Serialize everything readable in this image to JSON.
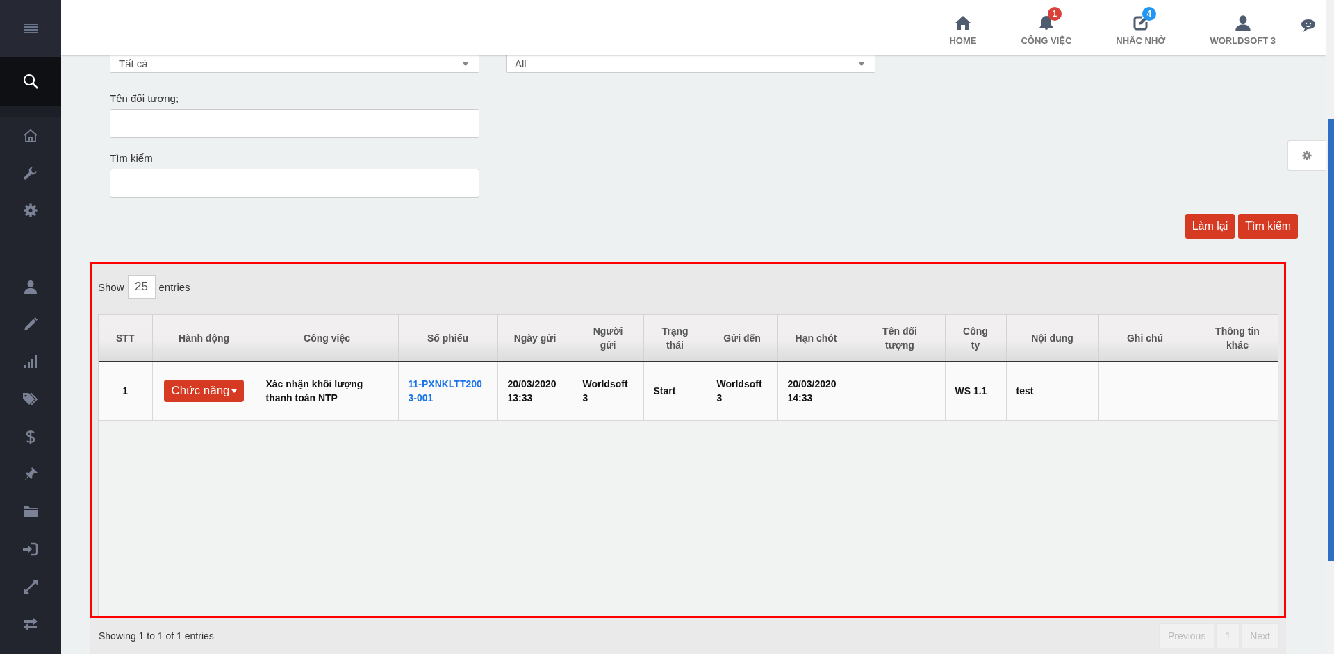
{
  "sidebar": {
    "items": [
      {
        "kind": "menu",
        "selected": false
      },
      {
        "kind": "search",
        "selected": true
      },
      {
        "kind": "home",
        "selected": false
      },
      {
        "kind": "wrench",
        "selected": false
      },
      {
        "kind": "gear",
        "selected": false
      },
      {
        "kind": "gap"
      },
      {
        "kind": "user",
        "selected": false
      },
      {
        "kind": "pencil",
        "selected": false
      },
      {
        "kind": "bars",
        "selected": false
      },
      {
        "kind": "tags",
        "selected": false
      },
      {
        "kind": "dollar",
        "selected": false
      },
      {
        "kind": "pin",
        "selected": false
      },
      {
        "kind": "folder",
        "selected": false
      },
      {
        "kind": "signin",
        "selected": false
      },
      {
        "kind": "expand",
        "selected": false
      },
      {
        "kind": "exchange",
        "selected": false
      }
    ]
  },
  "header": {
    "nav": [
      {
        "kind": "home",
        "label": "HOME"
      },
      {
        "kind": "bell",
        "label": "CÔNG VIỆC",
        "badge": "1",
        "color": "#d9413a"
      },
      {
        "kind": "edit",
        "label": "NHẮC NHỞ",
        "badge": "4",
        "color": "#2196f3"
      },
      {
        "kind": "user",
        "label": "WORLDSOFT 3"
      },
      {
        "kind": "chat"
      }
    ]
  },
  "filters": {
    "selects": [
      {
        "value": "Tất cả"
      },
      {
        "value": "All"
      }
    ],
    "fields": [
      {
        "label": "Tên đối tượng;"
      },
      {
        "label": "Tìm kiếm"
      }
    ],
    "buttons": [
      "Làm lại",
      "Tìm kiếm"
    ]
  },
  "table": {
    "highlighted": true,
    "show_label": "Show",
    "page_length": "25",
    "entries_label": "entries",
    "columns": [
      "STT",
      "Hành động",
      "Công việc",
      "Số phiếu",
      "Ngày gửi",
      "Người gửi",
      "Trạng thái",
      "Gửi đến",
      "Hạn chót",
      "Tên đối tượng",
      "Công ty",
      "Nội dung",
      "Ghi chú",
      "Thông tin khác"
    ],
    "rows": [
      [
        {
          "kind": "number",
          "text": "1"
        },
        {
          "kind": "action",
          "text": "Chức năng"
        },
        {
          "kind": "text",
          "text": "Xác nhận khối lượng thanh toán NTP"
        },
        {
          "kind": "link",
          "text": "11-PXNKLTT2003-001"
        },
        {
          "kind": "text",
          "text": "20/03/2020 13:33"
        },
        {
          "kind": "text",
          "text": "Worldsoft 3"
        },
        {
          "kind": "text",
          "text": "Start"
        },
        {
          "kind": "text",
          "text": "Worldsoft 3"
        },
        {
          "kind": "text",
          "text": "20/03/2020 14:33"
        },
        {
          "kind": "empty"
        },
        {
          "kind": "text",
          "text": "WS 1.1"
        },
        {
          "kind": "text",
          "text": "test"
        },
        {
          "kind": "empty"
        },
        {
          "kind": "empty"
        }
      ]
    ],
    "info": "Showing 1 to 1 of 1 entries",
    "pagination": [
      {
        "label": "Previous",
        "disabled": true
      },
      {
        "label": "1",
        "disabled": true
      },
      {
        "label": "Next",
        "disabled": true
      }
    ]
  }
}
